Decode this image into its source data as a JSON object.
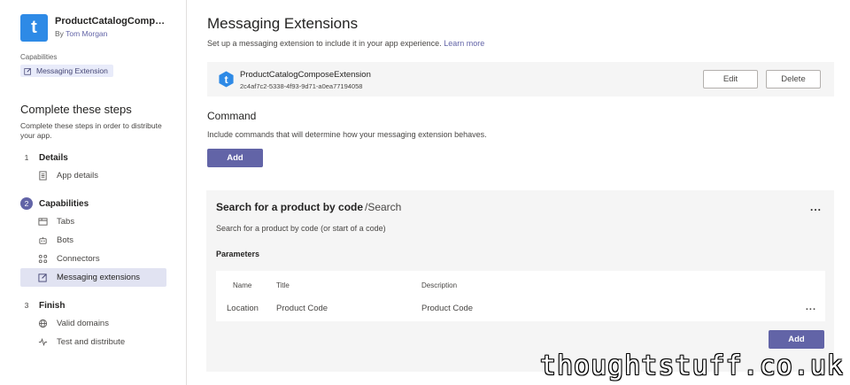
{
  "app": {
    "logo_letter": "t",
    "name": "ProductCatalogComposeExt...",
    "by_prefix": "By",
    "author": "Tom Morgan"
  },
  "capabilities": {
    "label": "Capabilities",
    "chip": "Messaging Extension"
  },
  "steps": {
    "title": "Complete these steps",
    "description": "Complete these steps in order to distribute your app.",
    "groups": [
      {
        "num": "1",
        "title": "Details",
        "active": false,
        "items": [
          {
            "label": "App details",
            "icon": "document-icon"
          }
        ]
      },
      {
        "num": "2",
        "title": "Capabilities",
        "active": true,
        "items": [
          {
            "label": "Tabs",
            "icon": "tab-icon"
          },
          {
            "label": "Bots",
            "icon": "bot-icon"
          },
          {
            "label": "Connectors",
            "icon": "connector-icon"
          },
          {
            "label": "Messaging extensions",
            "icon": "compose-icon",
            "selected": true
          }
        ]
      },
      {
        "num": "3",
        "title": "Finish",
        "active": false,
        "items": [
          {
            "label": "Valid domains",
            "icon": "globe-icon"
          },
          {
            "label": "Test and distribute",
            "icon": "pulse-icon"
          }
        ]
      }
    ]
  },
  "main": {
    "title": "Messaging Extensions",
    "subtitle": "Set up a messaging extension to include it in your app experience.",
    "learn_more": "Learn more",
    "extension": {
      "name": "ProductCatalogComposeExtension",
      "id": "2c4af7c2-5338-4f93-9d71-a0ea77194058",
      "edit_label": "Edit",
      "delete_label": "Delete"
    },
    "command_section": {
      "title": "Command",
      "description": "Include commands that will determine how your messaging extension behaves.",
      "add_label": "Add"
    },
    "command": {
      "title": "Search for a product by code",
      "id": "/Search",
      "more": "...",
      "description": "Search for a product by code (or start of a code)",
      "parameters_label": "Parameters",
      "columns": [
        "Name",
        "Title",
        "Description"
      ],
      "rows": [
        {
          "name": "Location",
          "title": "Product Code",
          "description": "Product Code"
        }
      ],
      "row_more": "...",
      "add_label": "Add"
    }
  },
  "watermark": "thoughtstuff.co.uk",
  "colors": {
    "accent": "#6264a7",
    "app_logo": "#2e8ae6",
    "chip_bg": "#e8ebfa"
  }
}
